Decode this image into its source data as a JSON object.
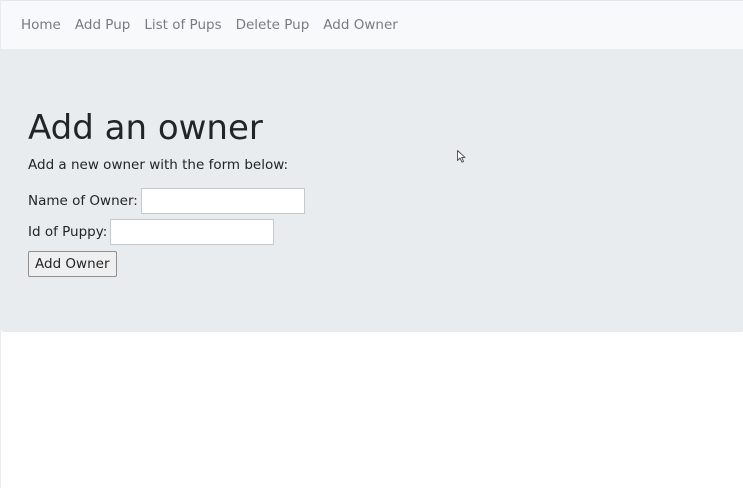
{
  "navbar": {
    "links": [
      {
        "label": "Home"
      },
      {
        "label": "Add Pup"
      },
      {
        "label": "List of Pups"
      },
      {
        "label": "Delete Pup"
      },
      {
        "label": "Add Owner"
      }
    ]
  },
  "main": {
    "title": "Add an owner",
    "description": "Add a new owner with the form below:",
    "form": {
      "owner_label": "Name of Owner:",
      "owner_value": "",
      "puppy_label": "Id of Puppy:",
      "puppy_value": "",
      "submit_label": "Add Owner"
    }
  },
  "cursor": {
    "icon": "mouse-pointer-icon"
  }
}
